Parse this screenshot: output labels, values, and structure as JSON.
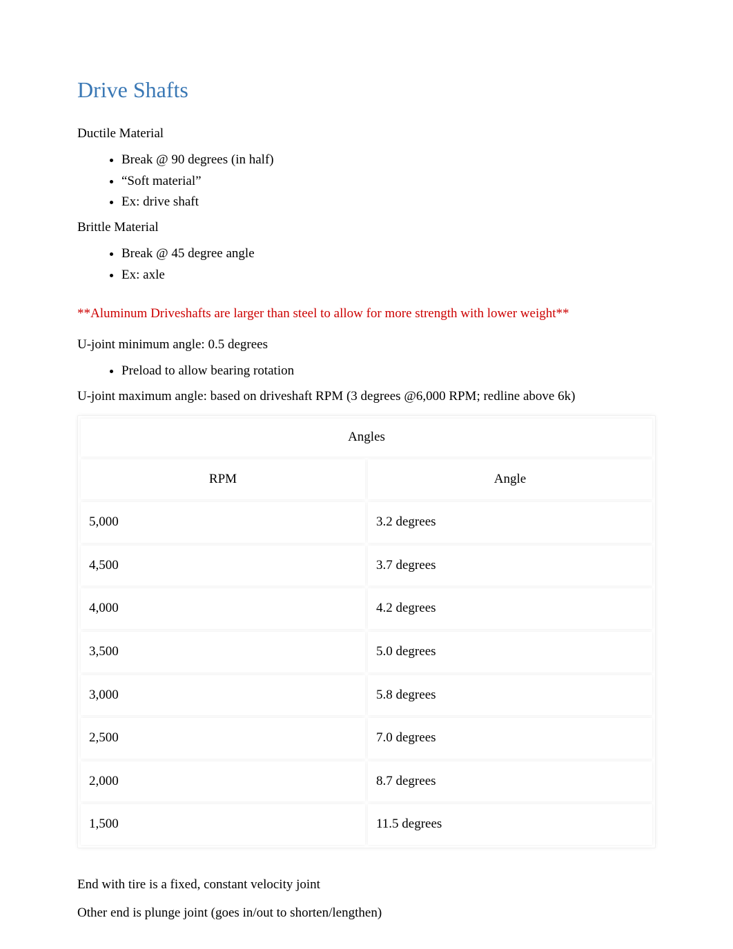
{
  "title": "Drive Shafts",
  "ductile": {
    "heading": "Ductile Material",
    "items": [
      "Break @ 90 degrees (in half)",
      "“Soft material”",
      "Ex: drive shaft"
    ]
  },
  "brittle": {
    "heading": "Brittle Material",
    "items": [
      "Break @ 45 degree angle",
      "Ex: axle"
    ]
  },
  "red_note": "**Aluminum Driveshafts are larger than steel to allow for more strength with lower weight**",
  "ujoint_min": "U-joint minimum angle: 0.5 degrees",
  "ujoint_min_items": [
    "Preload to allow bearing rotation"
  ],
  "ujoint_max": "U-joint maximum angle: based on driveshaft RPM (3 degrees @6,000 RPM; redline above 6k)",
  "table": {
    "title": "Angles",
    "col1": "RPM",
    "col2": "Angle",
    "rows": [
      {
        "rpm": "5,000",
        "angle": "3.2 degrees"
      },
      {
        "rpm": "4,500",
        "angle": "3.7 degrees"
      },
      {
        "rpm": "4,000",
        "angle": "4.2 degrees"
      },
      {
        "rpm": "3,500",
        "angle": "5.0 degrees"
      },
      {
        "rpm": "3,000",
        "angle": "5.8 degrees"
      },
      {
        "rpm": "2,500",
        "angle": "7.0 degrees"
      },
      {
        "rpm": "2,000",
        "angle": "8.7 degrees"
      },
      {
        "rpm": "1,500",
        "angle": "11.5 degrees"
      }
    ]
  },
  "footer": {
    "line1": "End with tire is a fixed, constant velocity joint",
    "line2": "Other end is plunge joint (goes in/out to shorten/lengthen)"
  },
  "chart_data": {
    "type": "table",
    "title": "Angles",
    "columns": [
      "RPM",
      "Angle (degrees)"
    ],
    "rows": [
      [
        5000,
        3.2
      ],
      [
        4500,
        3.7
      ],
      [
        4000,
        4.2
      ],
      [
        3500,
        5.0
      ],
      [
        3000,
        5.8
      ],
      [
        2500,
        7.0
      ],
      [
        2000,
        8.7
      ],
      [
        1500,
        11.5
      ]
    ]
  }
}
